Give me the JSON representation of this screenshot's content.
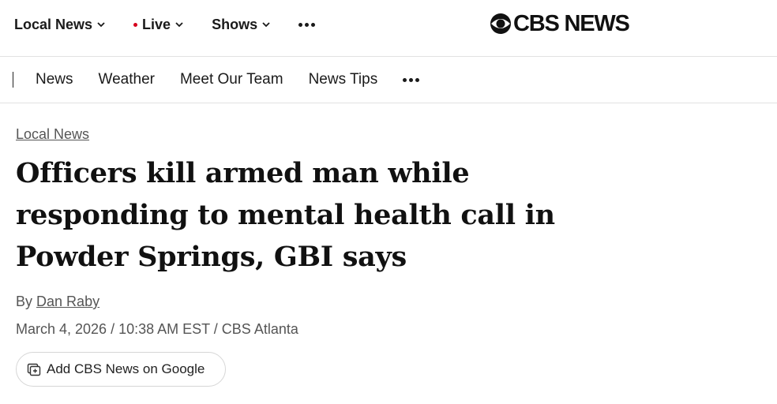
{
  "topnav": {
    "local_news": "Local News",
    "live": "Live",
    "shows": "Shows"
  },
  "logo": {
    "text": "CBS NEWS"
  },
  "subnav": {
    "items": [
      "News",
      "Weather",
      "Meet Our Team",
      "News Tips"
    ]
  },
  "article": {
    "section": "Local News",
    "headline": "Officers kill armed man while responding to mental health call in Powder Springs, GBI says",
    "byline_prefix": "By",
    "author": "Dan Raby",
    "dateline": "March 4, 2026 / 10:38 AM EST / CBS Atlanta"
  },
  "google_button": {
    "label": "Add CBS News on Google"
  },
  "icons": [
    "chevron-down-icon",
    "live-dot-icon",
    "more-icon",
    "cbs-eye-icon",
    "add-source-icon"
  ],
  "colors": {
    "live_dot": "#d6001c",
    "text": "#111111",
    "muted": "#555555",
    "border": "#e2e2e2"
  }
}
